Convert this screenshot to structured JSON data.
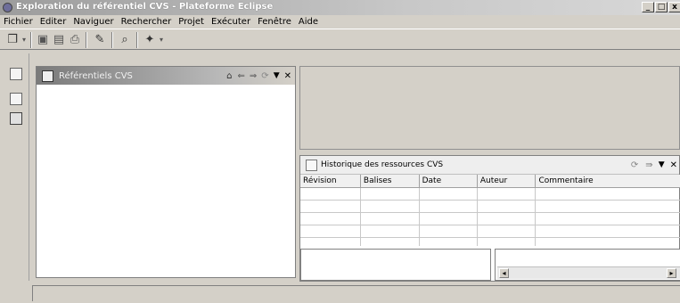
{
  "window": {
    "title": "Exploration du référentiel CVS - Plateforme Eclipse"
  },
  "menu": [
    "Fichier",
    "Editer",
    "Naviguer",
    "Rechercher",
    "Projet",
    "Exécuter",
    "Fenêtre",
    "Aide"
  ],
  "toolbar": {
    "icons": [
      "new-wizard-icon",
      "dropdown-icon",
      "save-icon",
      "save-all-icon",
      "print-icon",
      "edit-icon",
      "search-icon",
      "run-icon",
      "dropdown-icon"
    ]
  },
  "repositories_view": {
    "title": "Référentiels CVS"
  },
  "history_view": {
    "title": "Historique des ressources CVS",
    "columns": [
      "Révision",
      "Balises",
      "Date",
      "Auteur",
      "Commentaire"
    ]
  },
  "colors": {
    "accent": "#808080",
    "background": "#d4d0c8"
  }
}
